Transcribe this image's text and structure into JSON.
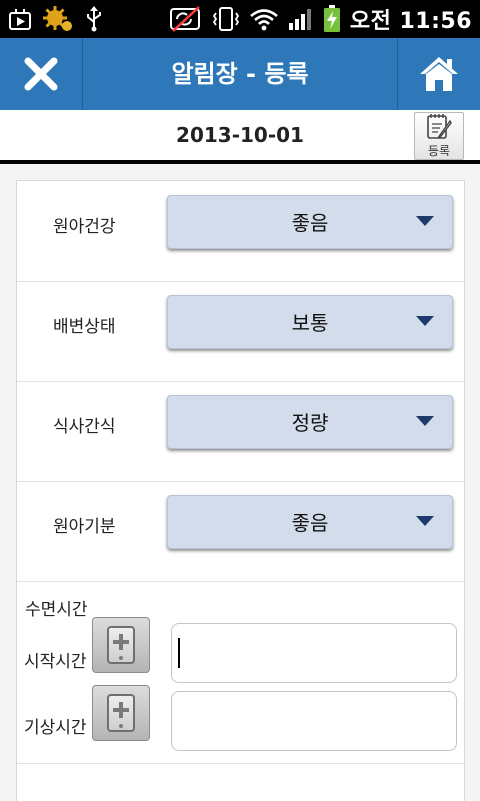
{
  "status_bar": {
    "time": "오전 11:56",
    "icons": [
      "play-store-icon",
      "gear-notification-icon",
      "usb-icon",
      "sync-off-icon",
      "vibrate-icon",
      "wifi-icon",
      "signal-icon",
      "battery-charging-icon"
    ]
  },
  "header": {
    "title": "알림장 - 등록",
    "close_icon": "close-icon",
    "home_icon": "home-icon"
  },
  "date_bar": {
    "date": "2013-10-01",
    "register_label": "등록",
    "register_icon": "notepad-pencil-icon"
  },
  "form": {
    "rows": [
      {
        "label": "원아건강",
        "value": "좋음"
      },
      {
        "label": "배변상태",
        "value": "보통"
      },
      {
        "label": "식사간식",
        "value": "정량"
      },
      {
        "label": "원아기분",
        "value": "좋음"
      }
    ],
    "sleep": {
      "title": "수면시간",
      "start_label": "시작시간",
      "start_value": "",
      "wake_label": "기상시간",
      "wake_value": ""
    }
  },
  "colors": {
    "header_blue": "#2e78b9",
    "select_bg": "#d3dceb",
    "arrow": "#1d3a6a"
  }
}
